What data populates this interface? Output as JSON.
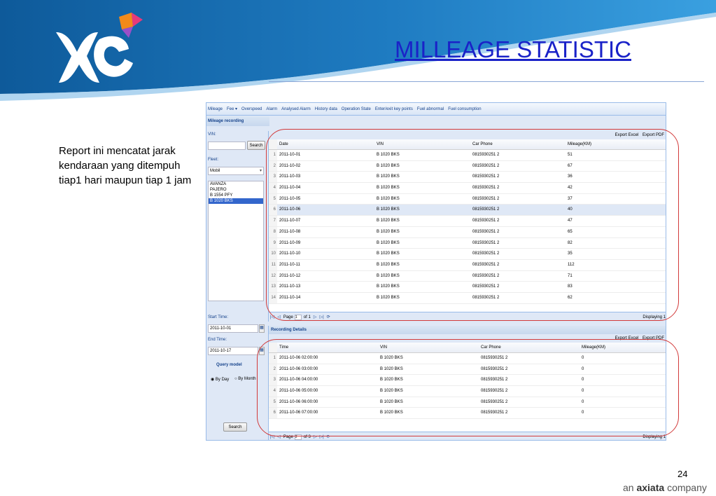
{
  "slide": {
    "title": "MILLEAGE STATISTIC",
    "description": "Report ini mencatat jarak kendaraan yang ditempuh tiap1 hari maupun tiap 1 jam",
    "page_number": "24",
    "footer_brand_prefix": "an",
    "footer_brand_name": "axiata",
    "footer_brand_suffix": "company"
  },
  "app": {
    "menu": [
      "Mileage",
      "Fee ▾",
      "Overspeed",
      "Alarm",
      "Analysed Alarm",
      "History data",
      "Operation State",
      "Enter/exit key points",
      "Fuel abnormal",
      "Fuel consumption"
    ],
    "panel_title": "Mileage recording",
    "left": {
      "vin_label": "VIN:",
      "vin_value": "",
      "search_label": "Search",
      "fleet_label": "Fleet:",
      "fleet_value": "Mobil",
      "vehicles": [
        "AVANZA",
        "PAJERO",
        "B 1554 PFY",
        "B 1020 BKS"
      ],
      "selected_vehicle_index": 3,
      "start_label": "Start Time:",
      "start_value": "2011-10-01",
      "end_label": "End Time:",
      "end_value": "2011-10-17",
      "query_model_label": "Query model",
      "by_day_label": "By Day",
      "by_month_label": "By Month",
      "search_button_label": "Search"
    },
    "top_grid": {
      "export_excel": "Export Excel",
      "export_pdf": "Export PDF",
      "columns": [
        "Date",
        "VIN",
        "Car Phone",
        "Mileage(KM)"
      ],
      "rows": [
        {
          "n": "1",
          "date": "2011-10-01",
          "vin": "B 1020 BKS",
          "phone": "0815930251 2",
          "km": "51"
        },
        {
          "n": "2",
          "date": "2011-10-02",
          "vin": "B 1020 BKS",
          "phone": "0815930251 2",
          "km": "67"
        },
        {
          "n": "3",
          "date": "2011-10-03",
          "vin": "B 1020 BKS",
          "phone": "0815930251 2",
          "km": "36"
        },
        {
          "n": "4",
          "date": "2011-10-04",
          "vin": "B 1020 BKS",
          "phone": "0815930251 2",
          "km": "42"
        },
        {
          "n": "5",
          "date": "2011-10-05",
          "vin": "B 1020 BKS",
          "phone": "0815930251 2",
          "km": "37"
        },
        {
          "n": "6",
          "date": "2011-10-06",
          "vin": "B 1020 BKS",
          "phone": "0815930251 2",
          "km": "40"
        },
        {
          "n": "7",
          "date": "2011-10-07",
          "vin": "B 1020 BKS",
          "phone": "0815930251 2",
          "km": "47"
        },
        {
          "n": "8",
          "date": "2011-10-08",
          "vin": "B 1020 BKS",
          "phone": "0815930251 2",
          "km": "65"
        },
        {
          "n": "9",
          "date": "2011-10-09",
          "vin": "B 1020 BKS",
          "phone": "0815930251 2",
          "km": "82"
        },
        {
          "n": "10",
          "date": "2011-10-10",
          "vin": "B 1020 BKS",
          "phone": "0815930251 2",
          "km": "35"
        },
        {
          "n": "11",
          "date": "2011-10-11",
          "vin": "B 1020 BKS",
          "phone": "0815930251 2",
          "km": "112"
        },
        {
          "n": "12",
          "date": "2011-10-12",
          "vin": "B 1020 BKS",
          "phone": "0815930251 2",
          "km": "71"
        },
        {
          "n": "13",
          "date": "2011-10-13",
          "vin": "B 1020 BKS",
          "phone": "0815930251 2",
          "km": "83"
        },
        {
          "n": "14",
          "date": "2011-10-14",
          "vin": "B 1020 BKS",
          "phone": "0815930251 2",
          "km": "62"
        }
      ],
      "highlighted_row_index": 5,
      "page_label": "Page",
      "page_value": "1",
      "of_label": "of 1",
      "displaying": "Displaying 1"
    },
    "detail_grid": {
      "title": "Recording Details",
      "export_excel": "Export Excel",
      "export_pdf": "Export PDF",
      "columns": [
        "Time",
        "VIN",
        "Car Phone",
        "Mileage(KM)"
      ],
      "rows": [
        {
          "n": "1",
          "time": "2011-10-06 02:00:00",
          "vin": "B 1020 BKS",
          "phone": "0815930251 2",
          "km": "0"
        },
        {
          "n": "2",
          "time": "2011-10-06 03:00:00",
          "vin": "B 1020 BKS",
          "phone": "0815930251 2",
          "km": "0"
        },
        {
          "n": "3",
          "time": "2011-10-06 04:00:00",
          "vin": "B 1020 BKS",
          "phone": "0815930251 2",
          "km": "0"
        },
        {
          "n": "4",
          "time": "2011-10-06 05:00:00",
          "vin": "B 1020 BKS",
          "phone": "0815930251 2",
          "km": "0"
        },
        {
          "n": "5",
          "time": "2011-10-06 06:00:00",
          "vin": "B 1020 BKS",
          "phone": "0815930251 2",
          "km": "0"
        },
        {
          "n": "6",
          "time": "2011-10-06 07:00:00",
          "vin": "B 1020 BKS",
          "phone": "0815930251 2",
          "km": "0"
        }
      ],
      "page_label": "Page",
      "page_value": "2",
      "of_label": "of 3",
      "displaying": "Displaying 1"
    }
  },
  "colors": {
    "banner_dark": "#0e5a9a",
    "banner_light": "#2b8fd6",
    "title": "#1a22c8",
    "annotation_oval": "#d23a3a",
    "selection": "#3366cc"
  }
}
